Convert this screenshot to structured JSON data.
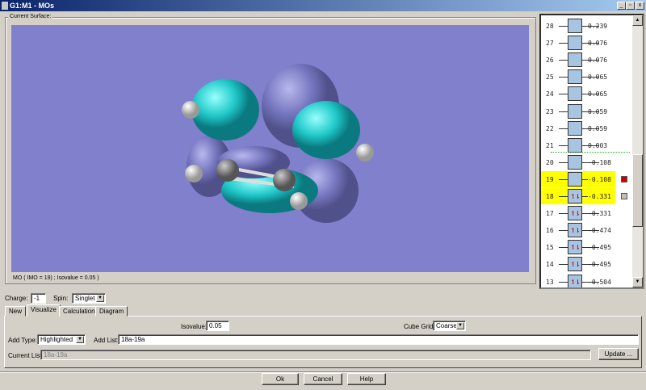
{
  "window": {
    "title": "G1:M1 - MOs",
    "minimize": "_",
    "maximize": "▫",
    "close": "x"
  },
  "surface": {
    "group_label": "Current Surface:",
    "status": "MO ( IMO = 19) ; Isovalue = 0.05 )",
    "background_color": "#8080cc"
  },
  "mo_list": [
    {
      "n": "28",
      "e": "0.239",
      "occ": ""
    },
    {
      "n": "27",
      "e": "0.076",
      "occ": ""
    },
    {
      "n": "26",
      "e": "0.076",
      "occ": ""
    },
    {
      "n": "25",
      "e": "0.065",
      "occ": ""
    },
    {
      "n": "24",
      "e": "0.065",
      "occ": ""
    },
    {
      "n": "23",
      "e": "0.059",
      "occ": ""
    },
    {
      "n": "22",
      "e": "0.059",
      "occ": ""
    },
    {
      "n": "21",
      "e": "0.003",
      "occ": ""
    },
    {
      "n": "20",
      "e": "-0.108",
      "occ": ""
    },
    {
      "n": "19",
      "e": "-0.108",
      "occ": "",
      "highlighted": true,
      "marker": "#cc0000"
    },
    {
      "n": "18",
      "e": "-0.331",
      "occ": "↿⇂",
      "highlighted": true,
      "marker": "#c0c0c0"
    },
    {
      "n": "17",
      "e": "-0.331",
      "occ": "↿⇂"
    },
    {
      "n": "16",
      "e": "-0.474",
      "occ": "↿⇂"
    },
    {
      "n": "15",
      "e": "-0.495",
      "occ": "↿⇂"
    },
    {
      "n": "14",
      "e": "-0.495",
      "occ": "↿⇂"
    },
    {
      "n": "13",
      "e": "-0.504",
      "occ": "↿⇂"
    }
  ],
  "controls": {
    "charge_label": "Charge:",
    "charge_value": "-1",
    "spin_label": "Spin:",
    "spin_value": "Singlet"
  },
  "tabs": [
    {
      "label": "New"
    },
    {
      "label": "Visualize",
      "active": true
    },
    {
      "label": "Calculation"
    },
    {
      "label": "Diagram"
    }
  ],
  "visualize": {
    "isovalue_label": "Isovalue:",
    "isovalue": "0.05",
    "cube_grid_label": "Cube Grid:",
    "cube_grid": "Coarse",
    "add_type_label": "Add Type:",
    "add_type": "Highlighted",
    "add_list_label": "Add List:",
    "add_list": "18a-19a",
    "current_list_label": "Current List:",
    "current_list": "18a-19a",
    "update_label": "Update ..."
  },
  "buttons": {
    "ok": "Ok",
    "cancel": "Cancel",
    "help": "Help"
  }
}
